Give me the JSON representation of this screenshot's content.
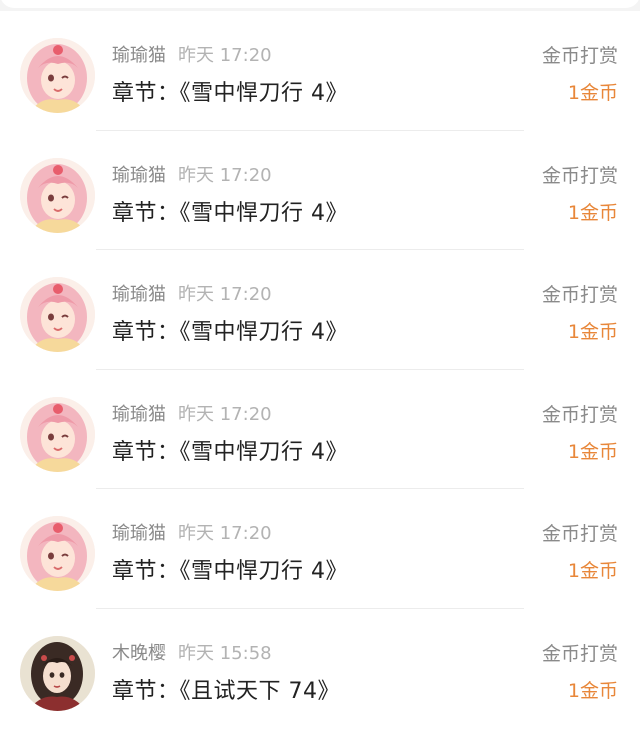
{
  "colors": {
    "background": "#f4f4f4",
    "card": "#ffffff",
    "name_text": "#8a8a8a",
    "time_text": "#b3b3b3",
    "chapter_text": "#222222",
    "amount_accent": "#e8873a"
  },
  "records": [
    {
      "avatar_icon": "pink-anime-girl-avatar-icon",
      "name": "瑜瑜猫",
      "time": "昨天 17:20",
      "chapter": "章节：《雪中悍刀行 4》",
      "type": "金币打赏",
      "amount": "1金币"
    },
    {
      "avatar_icon": "pink-anime-girl-avatar-icon",
      "name": "瑜瑜猫",
      "time": "昨天 17:20",
      "chapter": "章节：《雪中悍刀行 4》",
      "type": "金币打赏",
      "amount": "1金币"
    },
    {
      "avatar_icon": "pink-anime-girl-avatar-icon",
      "name": "瑜瑜猫",
      "time": "昨天 17:20",
      "chapter": "章节：《雪中悍刀行 4》",
      "type": "金币打赏",
      "amount": "1金币"
    },
    {
      "avatar_icon": "pink-anime-girl-avatar-icon",
      "name": "瑜瑜猫",
      "time": "昨天 17:20",
      "chapter": "章节：《雪中悍刀行 4》",
      "type": "金币打赏",
      "amount": "1金币"
    },
    {
      "avatar_icon": "pink-anime-girl-avatar-icon",
      "name": "瑜瑜猫",
      "time": "昨天 17:20",
      "chapter": "章节：《雪中悍刀行 4》",
      "type": "金币打赏",
      "amount": "1金币"
    },
    {
      "avatar_icon": "dark-haired-girl-avatar-icon",
      "name": "木晚樱",
      "time": "昨天 15:58",
      "chapter": "章节：《且试天下 74》",
      "type": "金币打赏",
      "amount": "1金币"
    }
  ]
}
